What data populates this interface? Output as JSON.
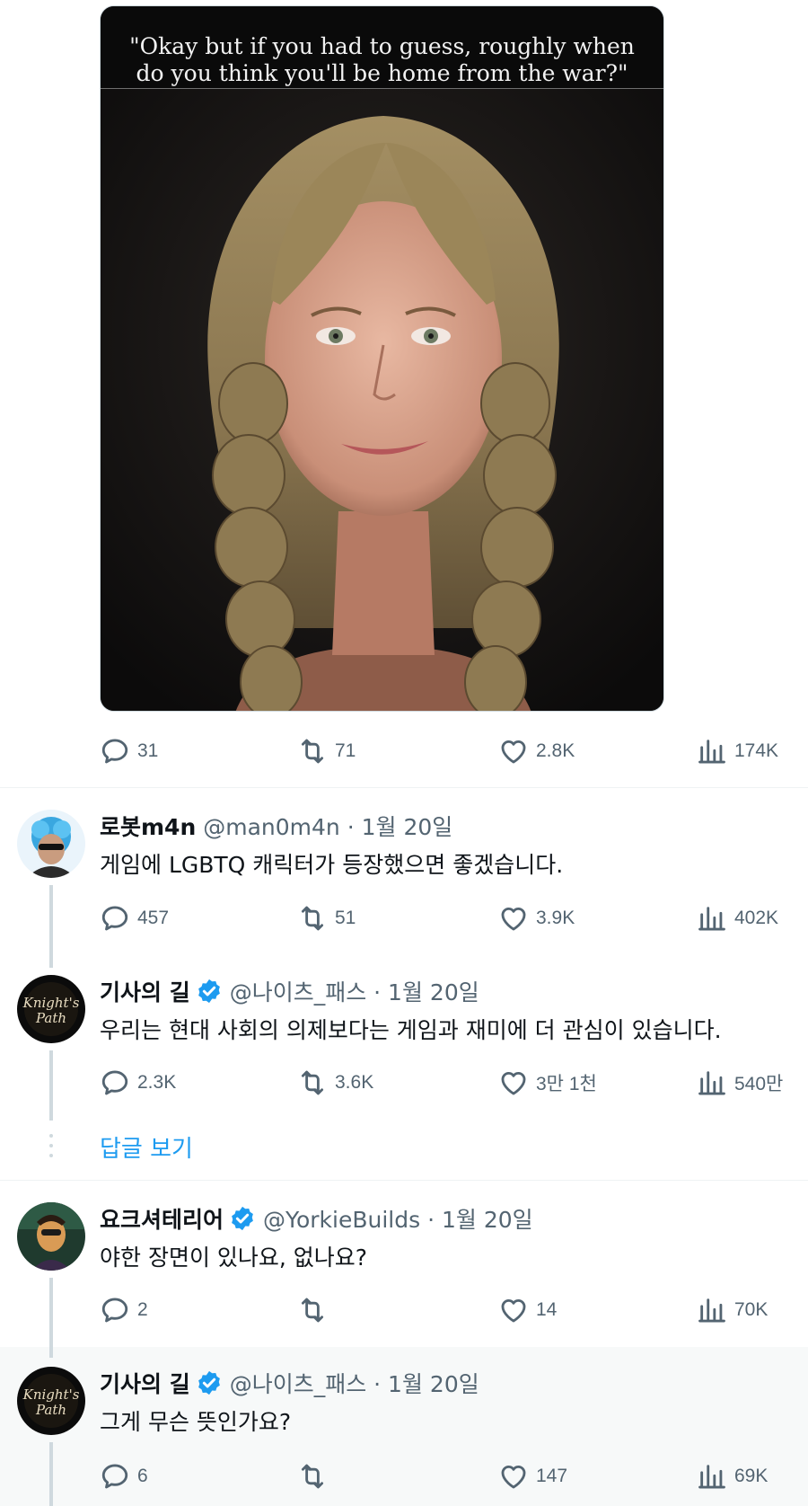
{
  "media": {
    "caption_line1": "\"Okay but if you had to guess, roughly when",
    "caption_line2": "do you think you'll be home from the war?\""
  },
  "main_stats": {
    "replies": "31",
    "reposts": "71",
    "likes": "2.8K",
    "views": "174K"
  },
  "tweets": [
    {
      "name": "로봇m4n",
      "verified": false,
      "meta": "@man0m4n · 1월 20일",
      "text": "게임에 LGBTQ 캐릭터가 등장했으면 좋겠습니다.",
      "stats": {
        "replies": "457",
        "reposts": "51",
        "likes": "3.9K",
        "views": "402K"
      }
    },
    {
      "name": "기사의 길",
      "verified": true,
      "meta": "@나이츠_패스 · 1월 20일",
      "text": "우리는 현대 사회의 의제보다는 게임과 재미에 더 관심이 있습니다.",
      "stats": {
        "replies": "2.3K",
        "reposts": "3.6K",
        "likes": "3만 1천",
        "views": "540만"
      },
      "avatar_text_1": "Knight's",
      "avatar_text_2": "Path"
    },
    {
      "name": "요크셔테리어",
      "verified": true,
      "meta": "@YorkieBuilds · 1월 20일",
      "text": "야한 장면이 있나요, 없나요?",
      "stats": {
        "replies": "2",
        "reposts": "",
        "likes": "14",
        "views": "70K"
      }
    },
    {
      "name": "기사의 길",
      "verified": true,
      "meta": "@나이츠_패스 · 1월 20일",
      "text": "그게 무슨 뜻인가요?",
      "stats": {
        "replies": "6",
        "reposts": "",
        "likes": "147",
        "views": "69K"
      },
      "avatar_text_1": "Knight's",
      "avatar_text_2": "Path"
    }
  ],
  "show_replies_label": "답글 보기",
  "colors": {
    "accent": "#1d9bf0",
    "muted": "#536471",
    "text": "#0f1419",
    "divider": "#eff3f4",
    "highlight_bg": "#f7f9f9"
  },
  "icons": [
    "reply-icon",
    "repost-icon",
    "like-icon",
    "views-icon",
    "verified-badge-icon"
  ]
}
